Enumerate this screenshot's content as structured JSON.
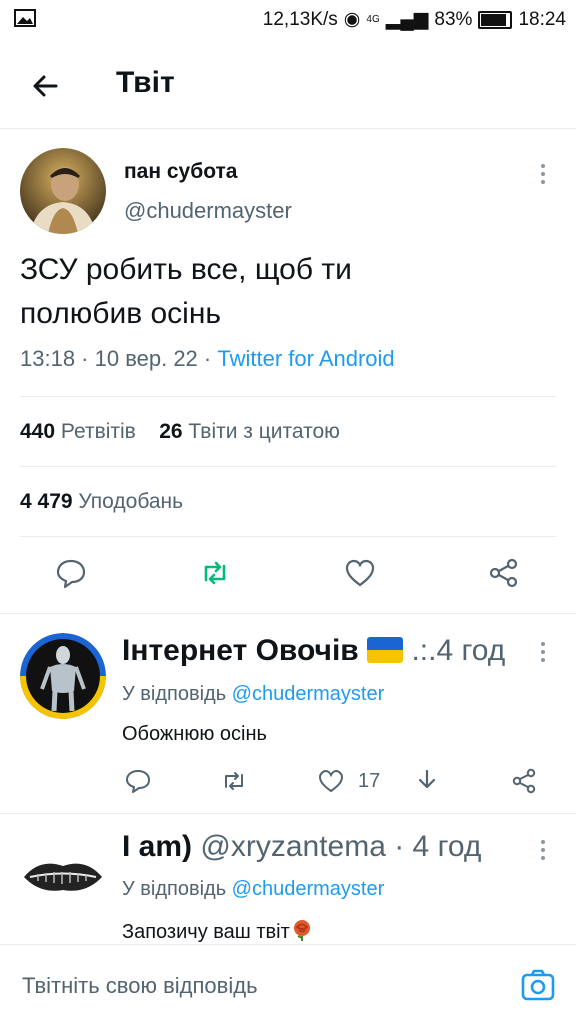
{
  "status": {
    "speed": "12,13K/s",
    "network": "4G",
    "battery": "83%",
    "time": "18:24"
  },
  "header": {
    "title": "Твіт"
  },
  "tweet": {
    "name": "пан субота",
    "handle": "@chudermayster",
    "text_line1": "ЗСУ робить все, щоб ти",
    "text_line2": "полюбив осінь",
    "time": "13:18 · 10 вер. 22 · ",
    "source": "Twitter for Android",
    "retweets_count": "440",
    "retweets_label": "Ретвітів",
    "quotes_count": "26",
    "quotes_label": "Твіти з цитатою",
    "likes_count": "4 479",
    "likes_label": "Уподобань"
  },
  "replies": [
    {
      "name": "Інтернет Овочів",
      "time": ".:.4 год",
      "reply_to_label": "У відповідь ",
      "reply_to_handle": "@chudermayster",
      "text": "Обожнюю осінь",
      "likes": "17"
    },
    {
      "name": "I am)",
      "handle": "@xryzantema",
      "time": " · 4 год",
      "reply_to_label": "У відповідь ",
      "reply_to_handle": "@chudermayster",
      "text": "Запозичу ваш твіт"
    }
  ],
  "compose": {
    "placeholder": "Твітніть свою відповідь"
  },
  "colors": {
    "accent": "#1d9bf0",
    "retweet_green": "#00ba7c",
    "muted": "#536471"
  }
}
